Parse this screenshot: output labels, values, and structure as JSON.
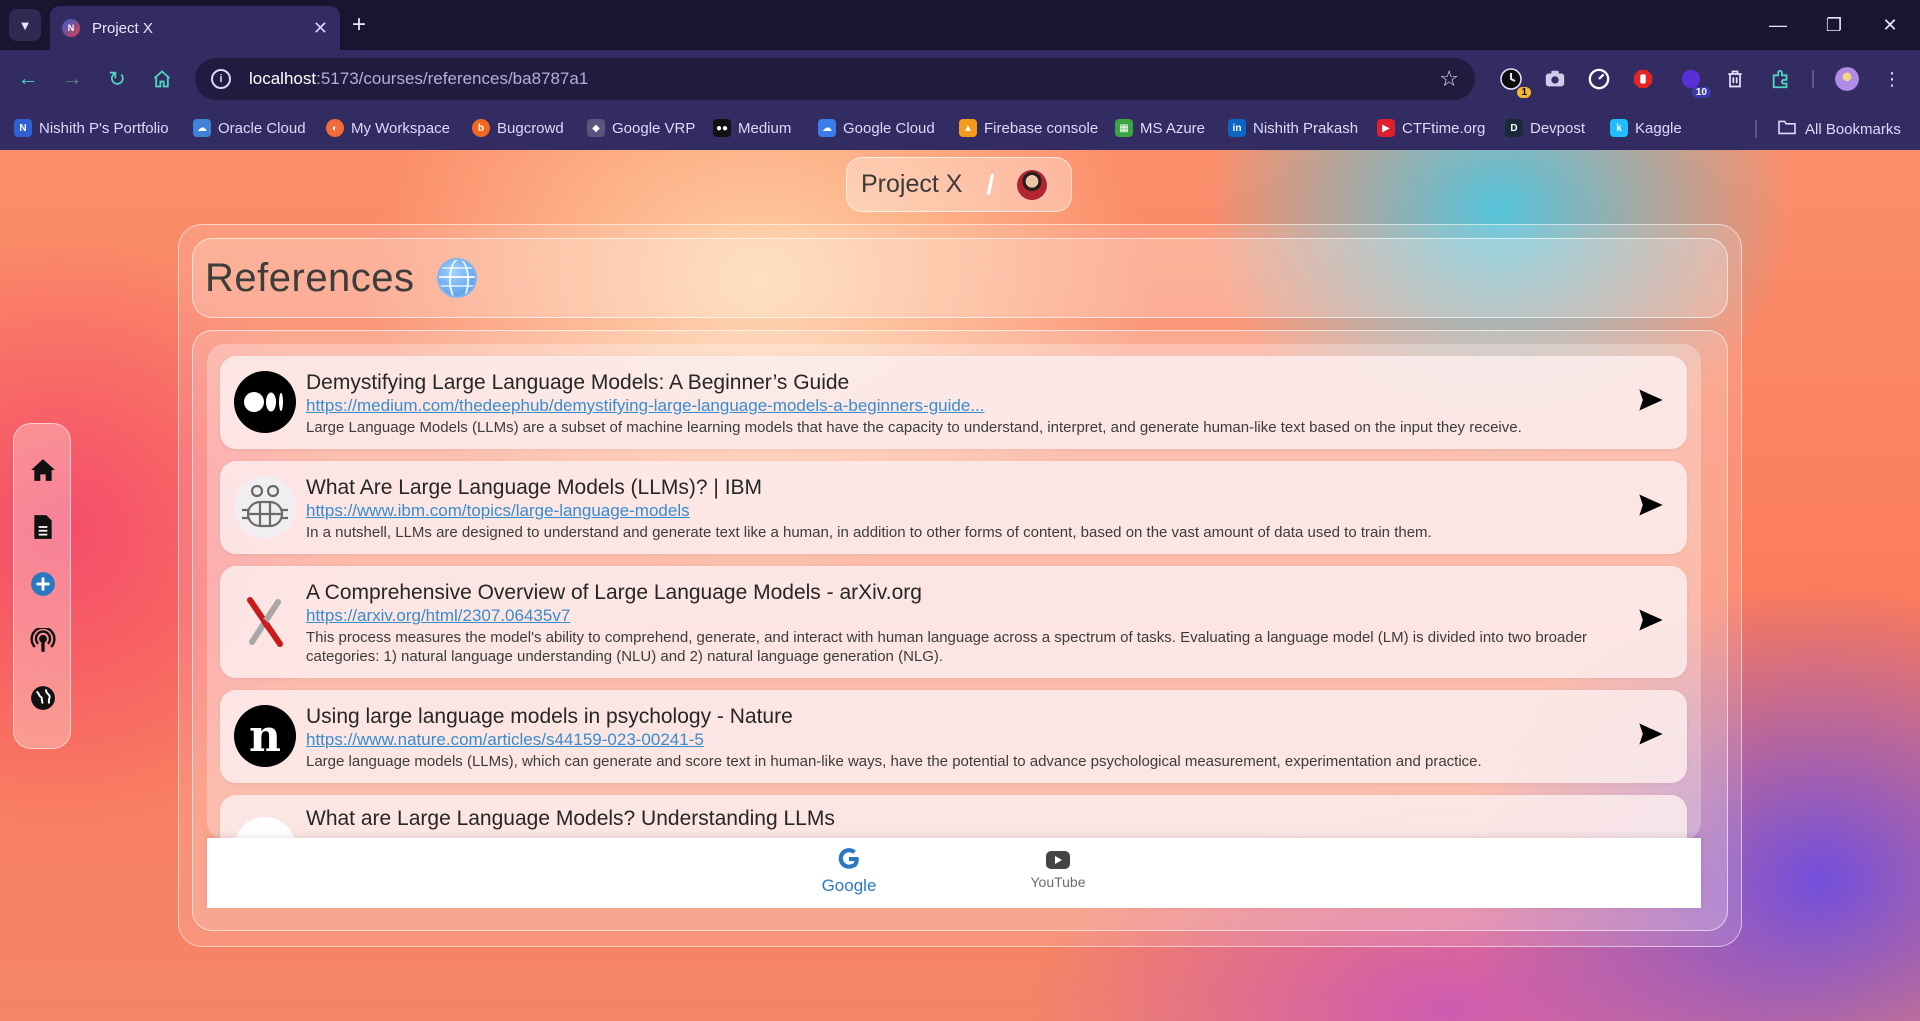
{
  "browser": {
    "tab_title": "Project X",
    "tab_favicon_text": "N",
    "url_host": "localhost",
    "url_path": ":5173/courses/references/ba8787a1",
    "extensions": [
      {
        "name": "clock-extension",
        "badge": "1"
      },
      {
        "name": "camera-extension",
        "badge": ""
      },
      {
        "name": "speed-extension",
        "badge": ""
      },
      {
        "name": "stop-extension",
        "badge": ""
      },
      {
        "name": "profile-extension",
        "badge": "10"
      },
      {
        "name": "trash-extension",
        "badge": ""
      },
      {
        "name": "puzzle-extension",
        "badge": ""
      }
    ],
    "bookmarks": [
      {
        "label": "Nishith P's Portfolio",
        "icon": "N",
        "color": "#2f5fd1"
      },
      {
        "label": "Oracle Cloud",
        "icon": "☁",
        "color": "#3f82d8"
      },
      {
        "label": "My Workspace",
        "icon": "◐",
        "color": "#f26b3a"
      },
      {
        "label": "Bugcrowd",
        "icon": "b",
        "color": "#f26822"
      },
      {
        "label": "Google VRP",
        "icon": "◆",
        "color": "#5a5480"
      },
      {
        "label": "Medium",
        "icon": "●●",
        "color": "#111111"
      },
      {
        "label": "Google Cloud",
        "icon": "☁",
        "color": "#3b7de8"
      },
      {
        "label": "Firebase console",
        "icon": "▲",
        "color": "#f59b1b"
      },
      {
        "label": "MS Azure",
        "icon": "▦",
        "color": "#3aa541"
      },
      {
        "label": "Nishith Prakash",
        "icon": "in",
        "color": "#0a66c2"
      },
      {
        "label": "CTFtime.org",
        "icon": "▶",
        "color": "#e01f2d"
      },
      {
        "label": "Devpost",
        "icon": "D",
        "color": "#1b2a3a"
      },
      {
        "label": "Kaggle",
        "icon": "k",
        "color": "#20beff"
      }
    ],
    "all_bookmarks": "All Bookmarks"
  },
  "header": {
    "project_name": "Project X",
    "separator": "/"
  },
  "page": {
    "title": "References",
    "title_icon": "globe-icon"
  },
  "references": [
    {
      "title": "Demystifying Large Language Models: A Beginner’s Guide",
      "url": "https://medium.com/thedeephub/demystifying-large-language-models-a-beginners-guide...",
      "description": "Large Language Models (LLMs) are a subset of machine learning models that have the capacity to understand, interpret, and generate human-like text based on the input they receive.",
      "source_icon": "medium-logo-icon"
    },
    {
      "title": "What Are Large Language Models (LLMs)? | IBM",
      "url": "https://www.ibm.com/topics/large-language-models",
      "description": "In a nutshell, LLMs are designed to understand and generate text like a human, in addition to other forms of content, based on the vast amount of data used to train them.",
      "source_icon": "ibm-logo-icon"
    },
    {
      "title": "A Comprehensive Overview of Large Language Models - arXiv.org",
      "url": "https://arxiv.org/html/2307.06435v7",
      "description": "This process measures the model's ability to comprehend, generate, and interact with human language across a spectrum of tasks. Evaluating a language model (LM) is divided into two broader categories: 1) natural language understanding (NLU) and 2) natural language generation (NLG).",
      "source_icon": "arxiv-logo-icon"
    },
    {
      "title": "Using large language models in psychology - Nature",
      "url": "https://www.nature.com/articles/s44159-023-00241-5",
      "description": "Large language models (LLMs), which can generate and score text in human-like ways, have the potential to advance psychological measurement, experimentation and practice.",
      "source_icon": "nature-logo-icon",
      "logo_text": "n"
    },
    {
      "title": "What are Large Language Models? Understanding LLMs",
      "url": "",
      "description": "",
      "source_icon": "blank-logo-icon"
    }
  ],
  "search_tabs": [
    {
      "label": "Google",
      "icon": "google-icon",
      "active": true
    },
    {
      "label": "YouTube",
      "icon": "youtube-icon",
      "active": false
    }
  ],
  "sidebar": [
    {
      "name": "home",
      "icon": "home-icon"
    },
    {
      "name": "document",
      "icon": "document-icon"
    },
    {
      "name": "add",
      "icon": "plus-circle-icon"
    },
    {
      "name": "podcast",
      "icon": "podcast-icon"
    },
    {
      "name": "globe",
      "icon": "globe-icon"
    }
  ],
  "colors": {
    "link": "#3a8ccd",
    "accent_blue": "#2a78c2",
    "tabbar": "#181530",
    "toolbar": "#332c62"
  }
}
